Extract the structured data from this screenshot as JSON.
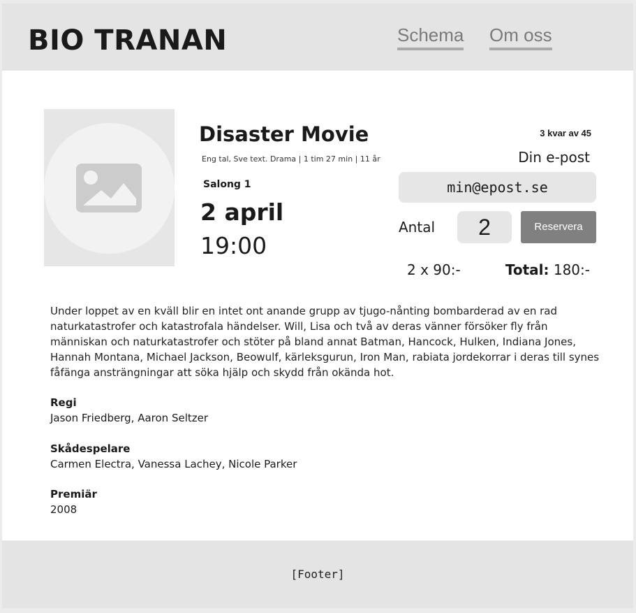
{
  "header": {
    "logo": "BIO TRANAN",
    "nav": [
      "Schema",
      "Om oss"
    ]
  },
  "movie": {
    "title": "Disaster Movie",
    "meta": "Eng tal, Sve text. Drama | 1 tim 27 min | 11 år",
    "salong": "Salong 1",
    "date": "2 april",
    "time": "19:00",
    "image_icon": "image-placeholder-icon"
  },
  "booking": {
    "seats_left": "3 kvar av 45",
    "email_label": "Din e-post",
    "email_value": "min@epost.se",
    "antal_label": "Antal",
    "quantity": "2",
    "reserve_label": "Reservera",
    "price_each": "2 x 90:-",
    "total_label": "Total:",
    "total_value": "180:-"
  },
  "details": {
    "description": "Under loppet av en kväll blir en intet ont anande grupp av tjugo-nånting bombarderad av en rad naturkatastrofer och katastrofala händelser. Will, Lisa och två av deras vänner försöker fly från människan och naturkatastrofer och stöter på bland annat Batman, Hancock, Hulken, Indiana Jones, Hannah Montana, Michael Jackson, Beowulf, kärleksgurun, Iron Man, rabiata jordekorrar i deras till synes fåfänga ansträngningar att söka hjälp och skydd från okända hot.",
    "regi_label": "Regi",
    "regi": "Jason Friedberg, Aaron Seltzer",
    "actors_label": "Skådespelare",
    "actors": "Carmen Electra, Vanessa Lachey, Nicole Parker",
    "premiar_label": "Premiär",
    "premiar": "2008"
  },
  "footer": {
    "text": "[Footer]"
  },
  "colors": {
    "page_bg": "#ececec",
    "header_bg": "#e4e4e4",
    "button_bg": "#808080",
    "input_bg": "#e6e6e6"
  }
}
